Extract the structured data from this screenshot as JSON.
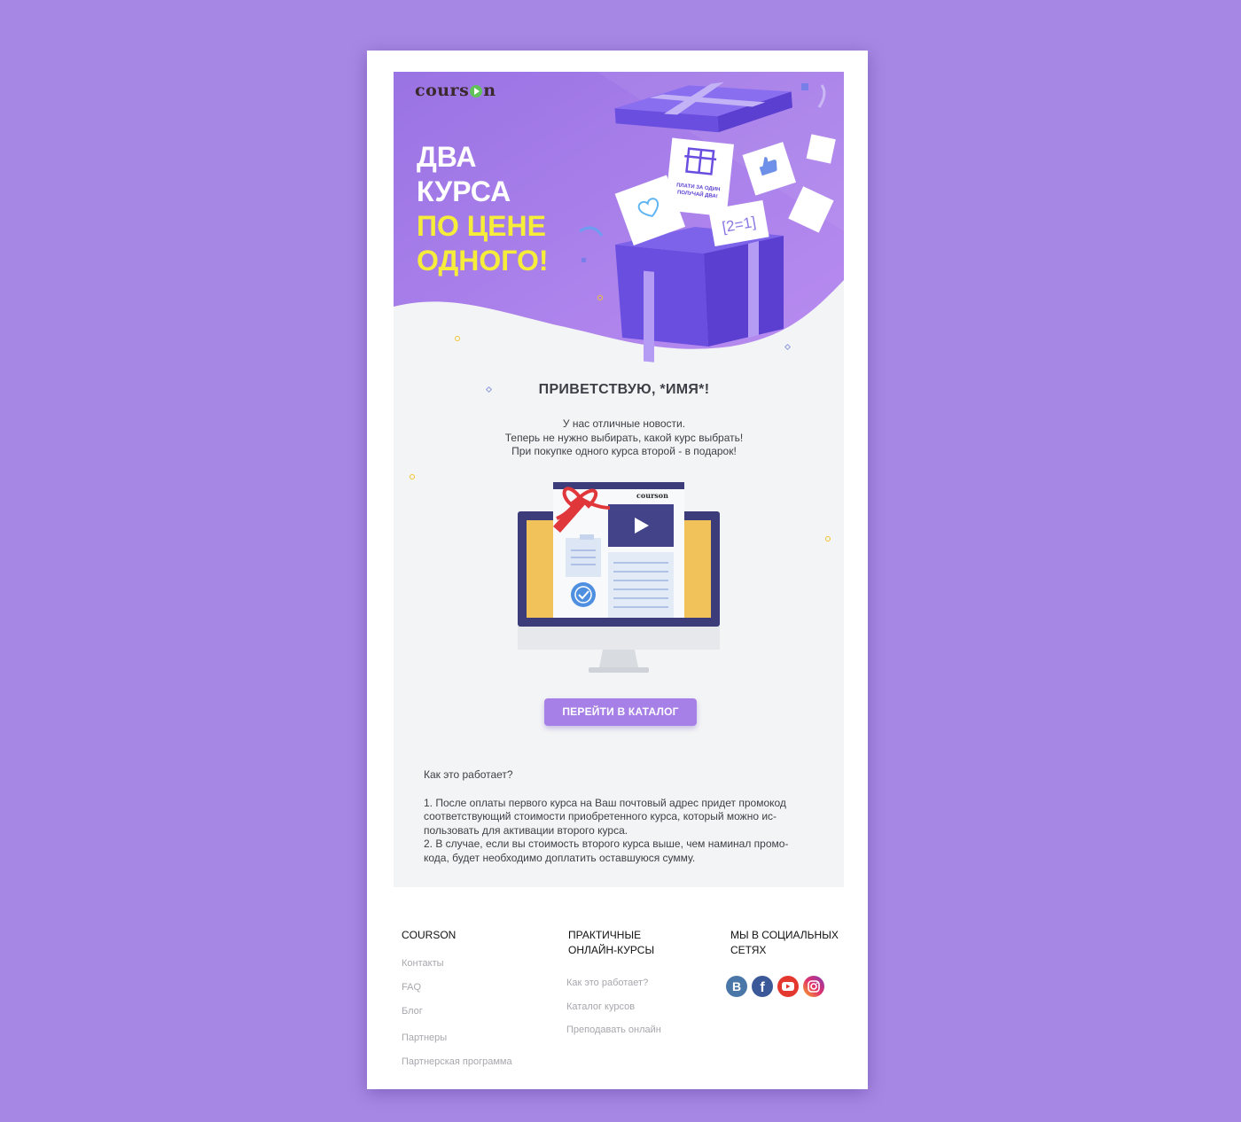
{
  "brand": {
    "logo_left": "cours",
    "logo_right": "n"
  },
  "hero": {
    "line1": "ДВА",
    "line2": "КУРСА",
    "line3": "ПО ЦЕНЕ",
    "line4": "ОДНОГО!",
    "card_text_1": "ПЛАТИ ЗА ОДИН",
    "card_text_2": "ПОЛУЧАЙ ДВА!",
    "equation": "[2=1]"
  },
  "greeting": "ПРИВЕТСТВУЮ, *ИМЯ*!",
  "intro": [
    "У нас отличные новости.",
    "Теперь не нужно выбирать, какой курс выбрать!",
    "При покупке одного курса второй -  в подарок!"
  ],
  "monitor": {
    "brand_small": "courson"
  },
  "cta_label": "ПЕРЕЙТИ В КАТАЛОГ",
  "how_it_works": {
    "title": "Как это работает?",
    "lines": [
      "1. После оплаты первого курса на Ваш почтовый адрес придет промокод",
      "соответствующий стоимости приобретенного курса, который можно ис-",
      "пользовать для активации второго курса.",
      "2. В случае, если вы стоимость второго курса выше, чем наминал промо-",
      "кода, будет необходимо доплатить оставшуюся сумму."
    ]
  },
  "footer": {
    "col1": {
      "heading": "COURSON",
      "links": [
        "Контакты",
        "FAQ",
        "Блог",
        "Партнеры",
        "Партнерская программа"
      ]
    },
    "col2": {
      "heading_1": "ПРАКТИЧНЫЕ",
      "heading_2": "ОНЛАЙН-КУРСЫ",
      "links": [
        "Как это работает?",
        "Каталог курсов",
        "Преподавать онлайн"
      ]
    },
    "col3": {
      "heading_1": "МЫ В СОЦИАЛЬНЫХ",
      "heading_2": "СЕТЯХ"
    }
  },
  "social": [
    {
      "name": "vk",
      "letter": "B",
      "color": "#4a76a8"
    },
    {
      "name": "facebook",
      "letter": "f",
      "color": "#3b5998"
    },
    {
      "name": "youtube",
      "color": "#e4382f"
    },
    {
      "name": "instagram",
      "color": "#c33a8a"
    }
  ],
  "colors": {
    "background": "#a688e4",
    "hero": "#a07ae6",
    "accent_yellow": "#f6ec3a",
    "button": "#a680e6"
  }
}
